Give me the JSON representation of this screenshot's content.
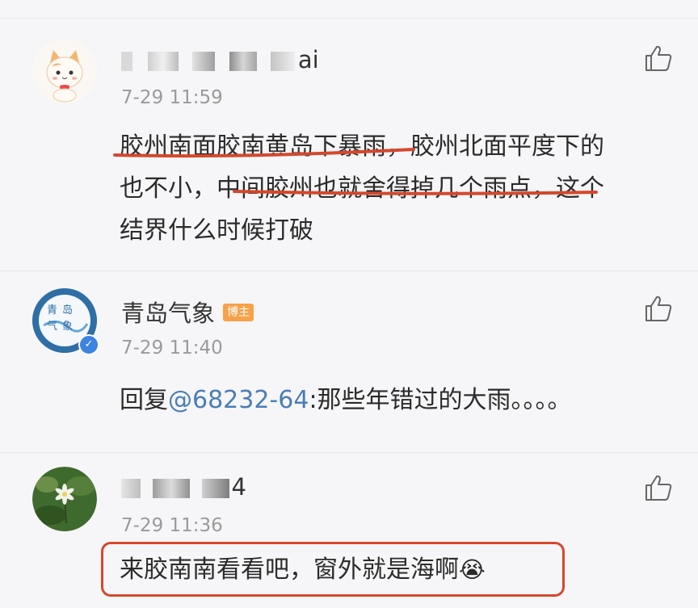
{
  "comments": [
    {
      "username_tail": "ai",
      "time": "7-29 11:59",
      "lines": [
        "胶州南面胶南黄岛下暴雨，胶州北面平度下的",
        "也不小，中间胶州也就舍得掉几个雨点，这个",
        "结界什么时候打破"
      ]
    },
    {
      "username": "青岛气象",
      "badge": "博主",
      "avatar_text": "青岛气象",
      "time": "7-29 11:40",
      "reply_prefix": "回复",
      "mention": "@68232-64",
      "reply_text": ":那些年错过的大雨。。。。"
    },
    {
      "username_tail": "4",
      "time": "7-29 11:36",
      "text": "来胶南南看看吧，窗外就是海啊",
      "emoji": "😭"
    }
  ],
  "colors": {
    "annotation_red": "#d4482c",
    "mention_blue": "#4a7db8",
    "badge_orange": "#f7a24a",
    "verified_blue": "#3b84e0"
  },
  "icons": [
    "cat-avatar",
    "thumbs-up-icon",
    "verified-icon",
    "plant-avatar",
    "crying-emoji"
  ]
}
